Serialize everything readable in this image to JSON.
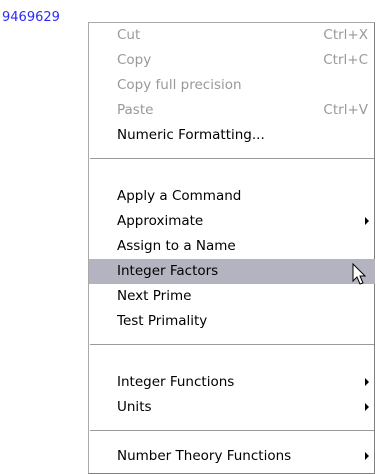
{
  "value_text": "9469629",
  "menu": {
    "clipboard": [
      {
        "label": "Cut",
        "shortcut": "Ctrl+X",
        "enabled": false
      },
      {
        "label": "Copy",
        "shortcut": "Ctrl+C",
        "enabled": false
      },
      {
        "label": "Copy full precision",
        "shortcut": "",
        "enabled": false
      },
      {
        "label": "Paste",
        "shortcut": "Ctrl+V",
        "enabled": false
      },
      {
        "label": "Numeric Formatting...",
        "shortcut": "",
        "enabled": true
      }
    ],
    "commands": [
      {
        "label": "Apply a Command",
        "submenu": false
      },
      {
        "label": "Approximate",
        "submenu": true
      },
      {
        "label": "Assign to a Name",
        "submenu": false
      },
      {
        "label": "Integer Factors",
        "submenu": false,
        "highlighted": true
      },
      {
        "label": "Next Prime",
        "submenu": false
      },
      {
        "label": "Test Primality",
        "submenu": false
      }
    ],
    "functions": [
      {
        "label": "Integer Functions",
        "submenu": true
      },
      {
        "label": "Units",
        "submenu": true
      }
    ],
    "theory": [
      {
        "label": "Number Theory Functions",
        "submenu": true
      }
    ]
  },
  "colors": {
    "value_text": "#2a2aff",
    "highlight_bg": "#b4b4c0",
    "disabled_text": "#999999"
  },
  "icons": {
    "cursor": "arrow-cursor-icon",
    "submenu": "submenu-arrow-icon"
  }
}
